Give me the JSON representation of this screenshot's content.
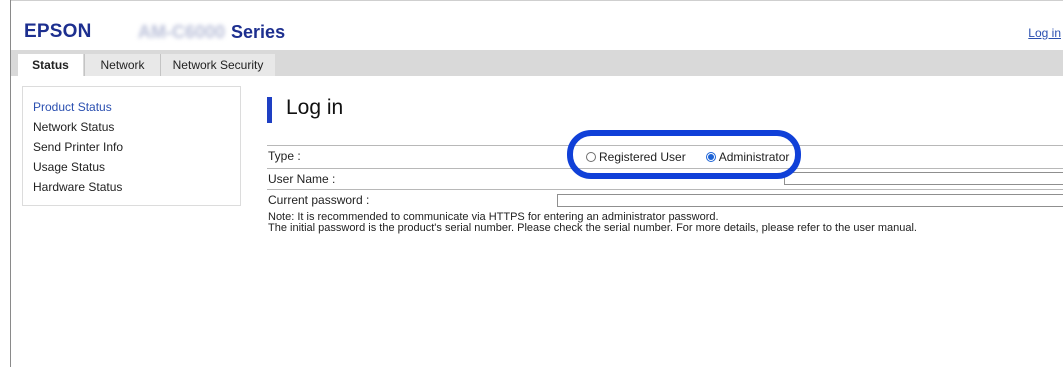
{
  "header": {
    "brand": "EPSON",
    "model_blurred": "AM-C6000",
    "model_suffix": "Series",
    "login_link": "Log in"
  },
  "tabs": [
    {
      "label": "Status",
      "active": true
    },
    {
      "label": "Network",
      "active": false
    },
    {
      "label": "Network Security",
      "active": false
    }
  ],
  "sidebar": {
    "items": [
      {
        "label": "Product Status",
        "current": true
      },
      {
        "label": "Network Status",
        "current": false
      },
      {
        "label": "Send Printer Info",
        "current": false
      },
      {
        "label": "Usage Status",
        "current": false
      },
      {
        "label": "Hardware Status",
        "current": false
      }
    ]
  },
  "main": {
    "title": "Log in",
    "form": {
      "type_label": "Type :",
      "type_options": [
        {
          "label": "Registered User",
          "checked": false
        },
        {
          "label": "Administrator",
          "checked": true
        }
      ],
      "username_label": "User Name :",
      "username_value": "",
      "password_label": "Current password :",
      "password_value": ""
    },
    "notes": [
      "Note: It is recommended to communicate via HTTPS for entering an administrator password.",
      "The initial password is the product's serial number. Please check the serial number. For more details, please refer to the user manual."
    ]
  },
  "colors": {
    "brand": "#1d2f8f",
    "accent": "#1e3fc3",
    "highlight": "#1040d8",
    "link": "#2a4fb0"
  }
}
